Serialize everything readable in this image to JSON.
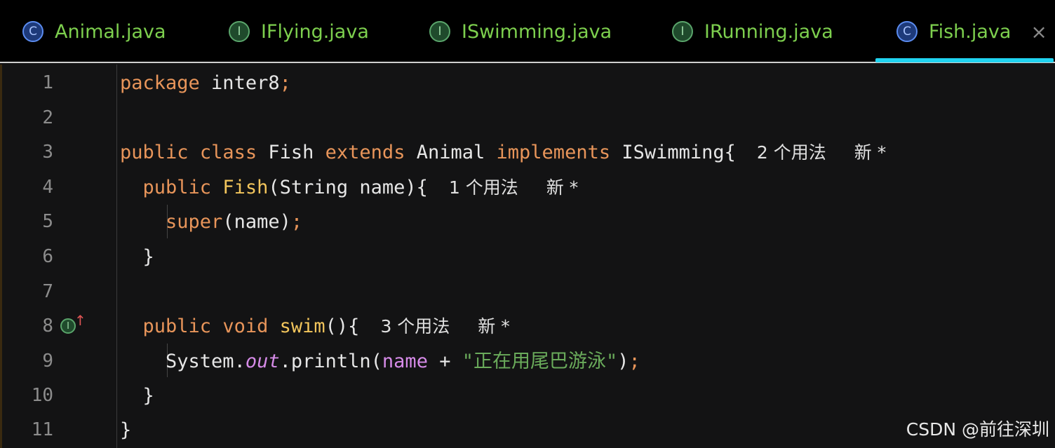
{
  "tabs": [
    {
      "label": "Animal.java",
      "icon": "class-icon",
      "icon_glyph": "C"
    },
    {
      "label": "IFlying.java",
      "icon": "interface-icon",
      "icon_glyph": "I"
    },
    {
      "label": "ISwimming.java",
      "icon": "interface-icon",
      "icon_glyph": "I"
    },
    {
      "label": "IRunning.java",
      "icon": "interface-icon",
      "icon_glyph": "I"
    },
    {
      "label": "Fish.java",
      "icon": "class-icon",
      "icon_glyph": "C",
      "active": true,
      "close": "×"
    }
  ],
  "colors": {
    "keyword": "#e8955a",
    "function": "#f2c55c",
    "field": "#d68be8",
    "string": "#6aab5b",
    "tab_text": "#7dcf4e",
    "active_tab_underline": "#20d3f0"
  },
  "code": {
    "line_numbers": [
      "1",
      "2",
      "3",
      "4",
      "5",
      "6",
      "7",
      "8",
      "9",
      "10",
      "11"
    ],
    "l1": {
      "kw": "package",
      "name": " inter8",
      "semi": ";"
    },
    "l3": {
      "kw1": "public",
      "kw2": "class",
      "name": "Fish",
      "kw3": "extends",
      "parent": "Animal",
      "kw4": "implements",
      "iface": "ISwimming{",
      "hint_usages": "2 个用法",
      "hint_new": "新 *"
    },
    "l4": {
      "kw": "public",
      "fn": "Fish",
      "rest": "(String name){",
      "hint_usages": "1 个用法",
      "hint_new": "新 *"
    },
    "l5": {
      "kw": "super",
      "rest": "(name)",
      "semi": ";"
    },
    "l6": {
      "brace": "}"
    },
    "l8": {
      "kw1": "public",
      "kw2": "void",
      "fn": "swim",
      "rest": "(){",
      "hint_usages": "3 个用法",
      "hint_new": "新 *",
      "gutter_icon_glyph": "I",
      "gutter_arrow": "↑"
    },
    "l9": {
      "sys": "System.",
      "out": "out",
      "println": ".println(",
      "field": "name",
      "plus": " + ",
      "str": "\"正在用尾巴游泳\"",
      "close": ")",
      "semi": ";"
    },
    "l10": {
      "brace": "}"
    },
    "l11": {
      "brace": "}"
    }
  },
  "watermark": "CSDN @前往深圳"
}
